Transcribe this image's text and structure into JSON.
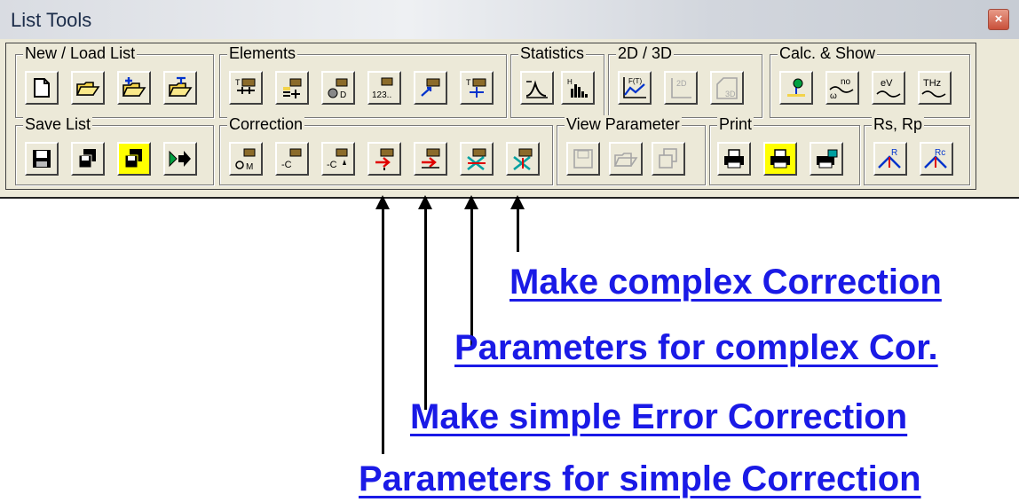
{
  "window": {
    "title": "List Tools",
    "close_glyph": "×"
  },
  "groups": {
    "new_load": "New / Load List",
    "elements": "Elements",
    "statistics": "Statistics",
    "view_2d3d": "2D / 3D",
    "calc_show": "Calc. & Show",
    "save": "Save List",
    "correction": "Correction",
    "view_param": "View Parameter",
    "print": "Print",
    "rs_rp": "Rs, Rp"
  },
  "icon_text": {
    "elements_d": "D",
    "elements_123": "123..",
    "elements_t": "T",
    "corr_m": "M",
    "corr_c1": "-C",
    "corr_c2": "-C",
    "view2d": "2D",
    "view3d": "3D",
    "stat_h": "H",
    "calc_no": "no",
    "calc_w": "ω",
    "calc_ev": "eV",
    "calc_thz": "THz",
    "rs": "R",
    "rp": "Rc",
    "ft": "F(T)"
  },
  "annotations": {
    "make_complex": "Make complex Correction",
    "params_complex": "Parameters for complex Cor.",
    "make_simple": "Make simple Error Correction",
    "params_simple": "Parameters for simple Correction"
  },
  "colors": {
    "annotation": "#1a1ae6",
    "panel": "#ece9d8",
    "highlight": "#ffff00"
  }
}
